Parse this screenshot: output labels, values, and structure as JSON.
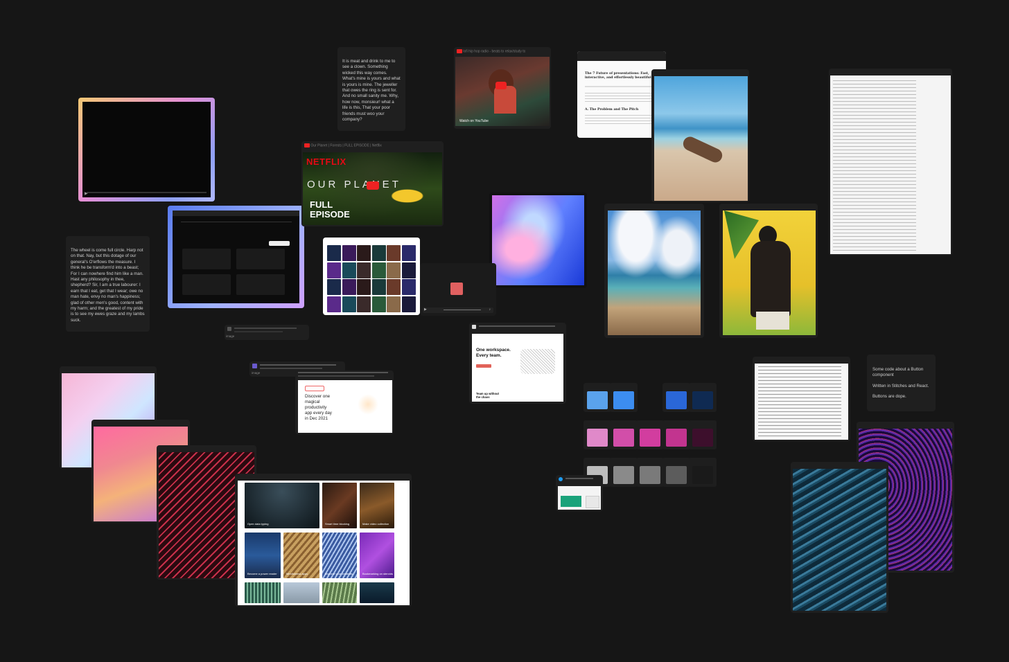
{
  "text_blocks": {
    "top": "It is meat and drink to me to see a clown. Something wicked this way comes. What's mine is yours and what is yours is mine. The jeweller that owes the ring is sent for. And no small sanity me. Why, how now, monsieur! what a life is this, That your poor friends must woo your company?",
    "left": "The wheel is come full circle. Harp not on that. Nay, but this dotage of our general's O'erflows the measure. I think he be transform'd into a beast; For I can nowhere find him like a man. Hast any philosophy in thee, shepherd? Sir, I am a true labourer: I earn that I eat, get that I wear; owe no man hate, envy no man's happiness; glad of other men's good, content with my harm; and the greatest of my pride is to see my ewes graze and my lambs suck.",
    "right_1": "Some code about a Button component",
    "right_2": "Written in Stitches and React.",
    "right_3": "Buttons are dope."
  },
  "video_cards": {
    "lofi_title": "lofi hip hop radio - beats to relax/study to",
    "planet_title": "Our Planet | Forests | FULL EPISODE | Netflix",
    "planet_brand": "NETFLIX",
    "planet_show": "OUR PLANET",
    "planet_full": "FULL",
    "planet_episode": "EPISODE",
    "youtube": "YouTube",
    "watch_on": "Watch on"
  },
  "article": {
    "title": "The 7 Future of presentations: Fast, interactive, and effortlessly beautiful",
    "heading": "A. The Problem and The Pitch"
  },
  "notion": {
    "headline_1": "One workspace.",
    "headline_2": "Every team.",
    "team_1": "Team up without",
    "team_2": "the chaos"
  },
  "producthunt": {
    "line_1": "Discover one",
    "line_2": "magical",
    "line_3": "productivity",
    "line_4": "app every day",
    "line_5": "in Dec 2021"
  },
  "image_card_tags": {
    "image_1": "image",
    "image_2": "image"
  },
  "gallery_labels": [
    "Open data typing",
    "Smart time blocking",
    "Make video collection",
    "Become a power reader",
    "Mindfulness apps",
    "Improve your creativity",
    "Bookmarking on steroids"
  ],
  "colors": {
    "background": "#161616",
    "card": "#1f1f1f",
    "blues": [
      "#5aa2ec",
      "#3c8df0",
      "#2a67d8",
      "#0f2a52"
    ],
    "pinks": [
      "#e089c9",
      "#d24ea9",
      "#d23d9f",
      "#c2348f",
      "#3d0f2c"
    ],
    "grays": [
      "#bdbdbd",
      "#8a8a8a",
      "#7a7a7a",
      "#5c5c5c",
      "#1a1a1a"
    ],
    "netflix_red": "#e50914"
  },
  "icons": [
    "play-icon",
    "youtube-icon",
    "twitter-icon",
    "volume-icon",
    "fullscreen-icon",
    "notion-icon"
  ]
}
